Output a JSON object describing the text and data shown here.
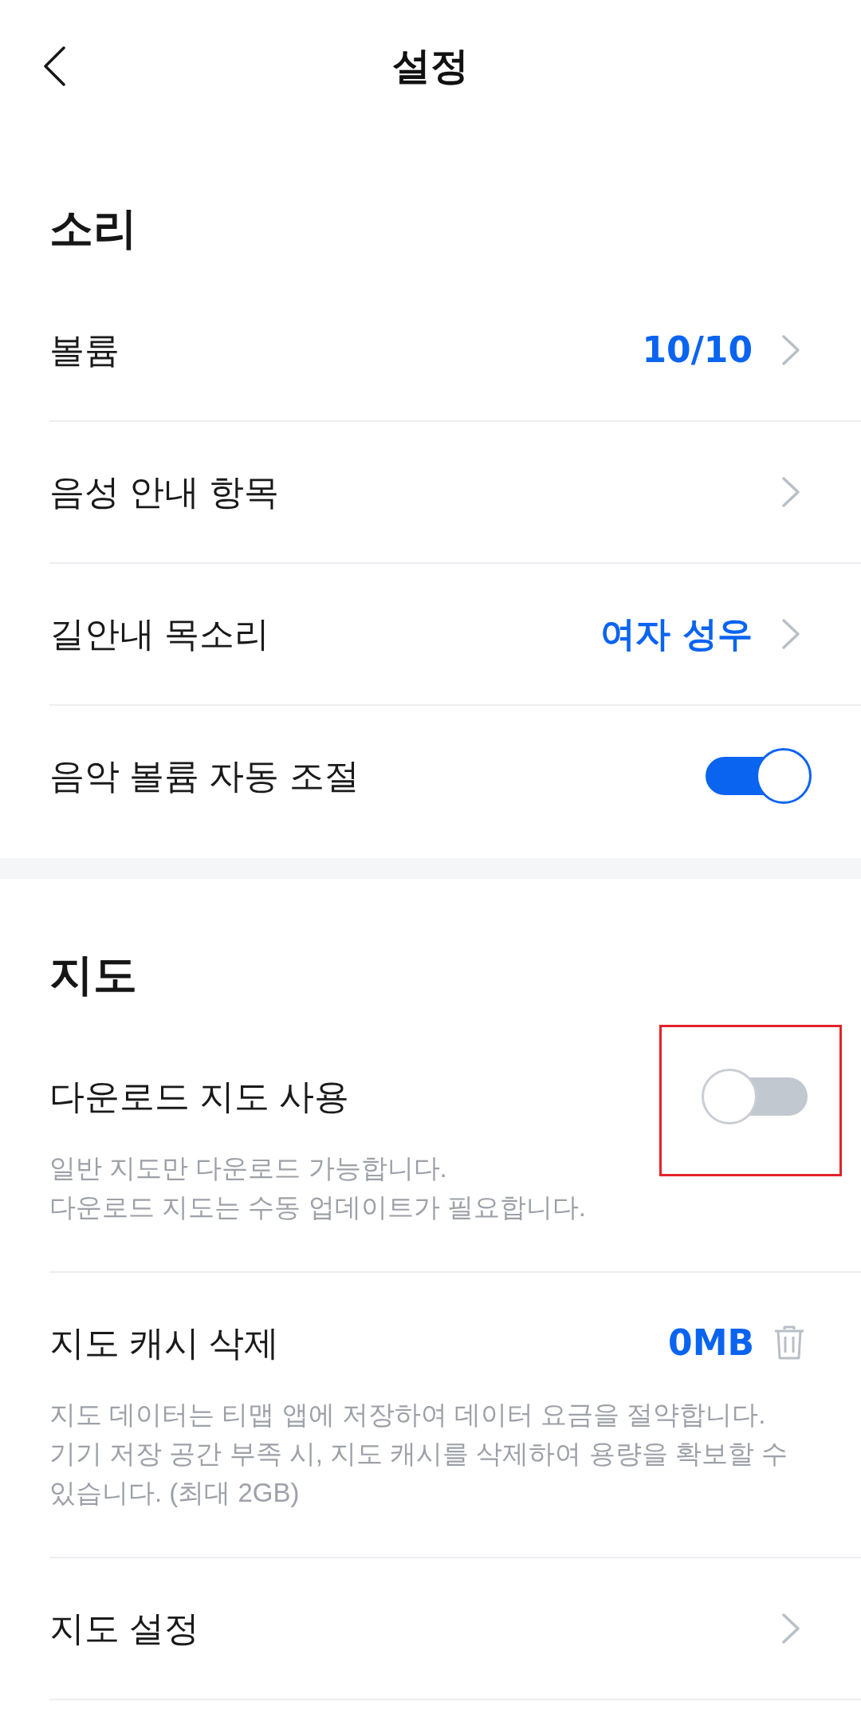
{
  "header": {
    "title": "설정"
  },
  "sections": [
    {
      "title": "소리",
      "items": [
        {
          "kind": "link",
          "label": "볼륨",
          "value": "10/10",
          "highlighted": false
        },
        {
          "kind": "link",
          "label": "음성 안내 항목",
          "highlighted": false
        },
        {
          "kind": "link",
          "label": "길안내 목소리",
          "value": "여자 성우",
          "highlighted": false
        },
        {
          "kind": "toggle",
          "label": "음악 볼륨 자동 조절",
          "on": true,
          "highlighted": false
        }
      ]
    },
    {
      "title": "지도",
      "items": [
        {
          "kind": "toggle",
          "label": "다운로드 지도 사용",
          "on": false,
          "highlighted": true,
          "description": "일반 지도만 다운로드 가능합니다.\n다운로드 지도는 수동 업데이트가 필요합니다."
        },
        {
          "kind": "action",
          "label": "지도 캐시 삭제",
          "value": "0MB",
          "highlighted": false,
          "description": "지도 데이터는 티맵 앱에 저장하여 데이터 요금을 절약합니다. 기기 저장 공간 부족 시, 지도 캐시를 삭제하여 용량을 확보할 수 있습니다. (최대 2GB)"
        },
        {
          "kind": "link",
          "label": "지도 설정",
          "highlighted": false
        }
      ]
    }
  ]
}
